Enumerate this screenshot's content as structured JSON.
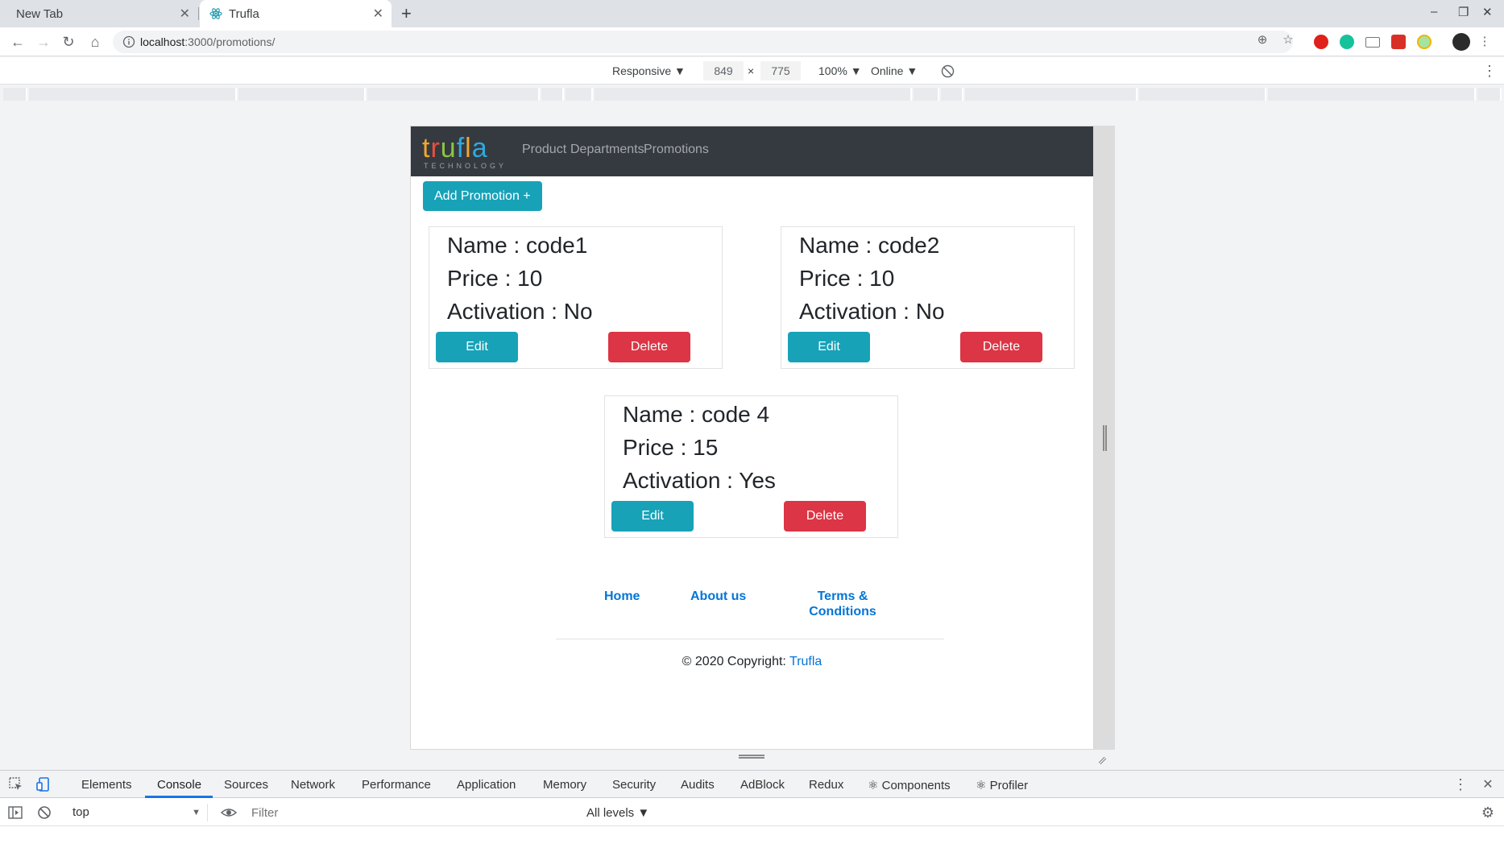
{
  "browser": {
    "tabs": [
      {
        "title": "New Tab",
        "active": false
      },
      {
        "title": "Trufla",
        "active": true
      }
    ],
    "url_host": "localhost",
    "url_path": ":3000/promotions/",
    "new_tab_symbol": "+",
    "close_symbol": "✕",
    "window_controls": [
      "–",
      "❐",
      "✕"
    ]
  },
  "device_toolbar": {
    "device": "Responsive ▼",
    "width": "849",
    "times": "×",
    "height": "775",
    "zoom": "100% ▼",
    "throttle": "Online ▼"
  },
  "app": {
    "logo_word": "trufla",
    "logo_sub": "TECHNOLOGY",
    "nav_links": [
      "Product",
      "Departments",
      "Promotions"
    ],
    "add_button": "Add Promotion +",
    "promotions": [
      {
        "name": "Name : code1",
        "price": "Price : 10",
        "activation": "Activation : No",
        "edit": "Edit",
        "delete": "Delete"
      },
      {
        "name": "Name : code2",
        "price": "Price : 10",
        "activation": "Activation : No",
        "edit": "Edit",
        "delete": "Delete"
      },
      {
        "name": "Name : code 4",
        "price": "Price : 15",
        "activation": "Activation : Yes",
        "edit": "Edit",
        "delete": "Delete"
      }
    ],
    "footer": {
      "links": [
        "Home",
        "About us",
        "Terms &",
        "Conditions"
      ],
      "copyright_prefix": "© 2020 Copyright: ",
      "copyright_brand": "Trufla"
    },
    "colors": {
      "navbar": "#343a40",
      "info": "#17a2b8",
      "danger": "#dc3545",
      "link": "#0275d8"
    }
  },
  "devtools": {
    "tabs": [
      "Elements",
      "Console",
      "Sources",
      "Network",
      "Performance",
      "Application",
      "Memory",
      "Security",
      "Audits",
      "AdBlock",
      "Redux",
      "⚛ Components",
      "⚛ Profiler"
    ],
    "context": "top",
    "filter_placeholder": "Filter",
    "levels": "All levels ▼"
  }
}
